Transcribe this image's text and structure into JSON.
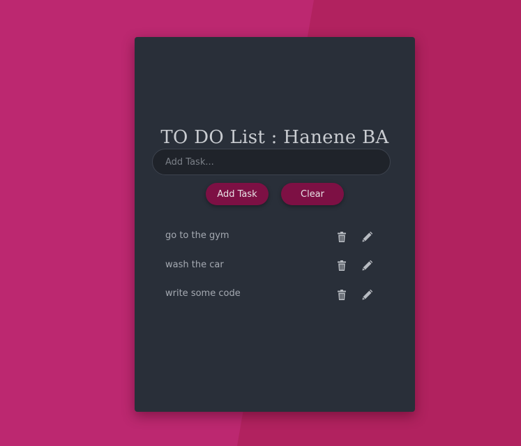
{
  "app": {
    "title": "TO DO List : Hanene BA"
  },
  "input": {
    "placeholder": "Add Task...",
    "value": ""
  },
  "buttons": {
    "add_label": "Add Task",
    "clear_label": "Clear"
  },
  "tasks": [
    {
      "text": "go to the gym",
      "delete_icon": "trash-icon",
      "edit_icon": "pencil-icon"
    },
    {
      "text": "wash the car",
      "delete_icon": "trash-icon",
      "edit_icon": "pencil-icon"
    },
    {
      "text": "write some code",
      "delete_icon": "trash-icon",
      "edit_icon": "pencil-icon"
    }
  ],
  "colors": {
    "background": "#b1225f",
    "card": "#292f39",
    "button": "#7d1044",
    "icon": "#b8bcc2"
  }
}
